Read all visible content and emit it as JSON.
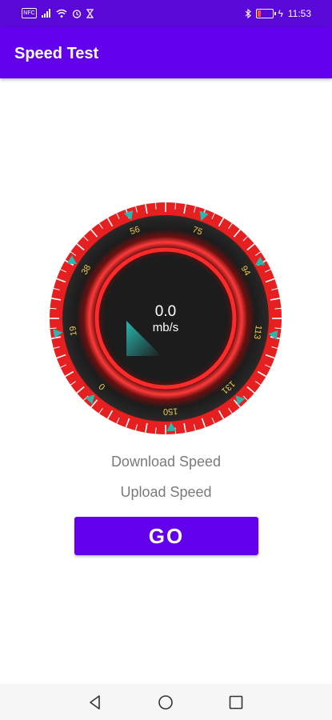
{
  "status_bar": {
    "time": "11:53",
    "nfc_label": "NFC",
    "background": "#5a08d8",
    "icons": [
      "nfc-icon",
      "signal-icon",
      "wifi-icon",
      "alarm-icon",
      "hourglass-icon",
      "bluetooth-icon",
      "battery-icon",
      "charging-icon"
    ]
  },
  "app_bar": {
    "title": "Speed Test",
    "background": "#6200ee"
  },
  "gauge": {
    "value": "0.0",
    "unit": "mb/s",
    "tick_labels": [
      "0",
      "19",
      "38",
      "56",
      "75",
      "94",
      "113",
      "131",
      "150"
    ],
    "ring_color": "#e62020",
    "face_color": "#1c1c1c",
    "marker_color": "#2ab7b0",
    "label_color": "#f2c94c"
  },
  "labels": {
    "download": "Download Speed",
    "upload": "Upload Speed"
  },
  "go_button": {
    "label": "GO",
    "color": "#6200ee"
  },
  "nav_bar": {
    "items": [
      "back-icon",
      "home-icon",
      "recents-icon"
    ]
  }
}
